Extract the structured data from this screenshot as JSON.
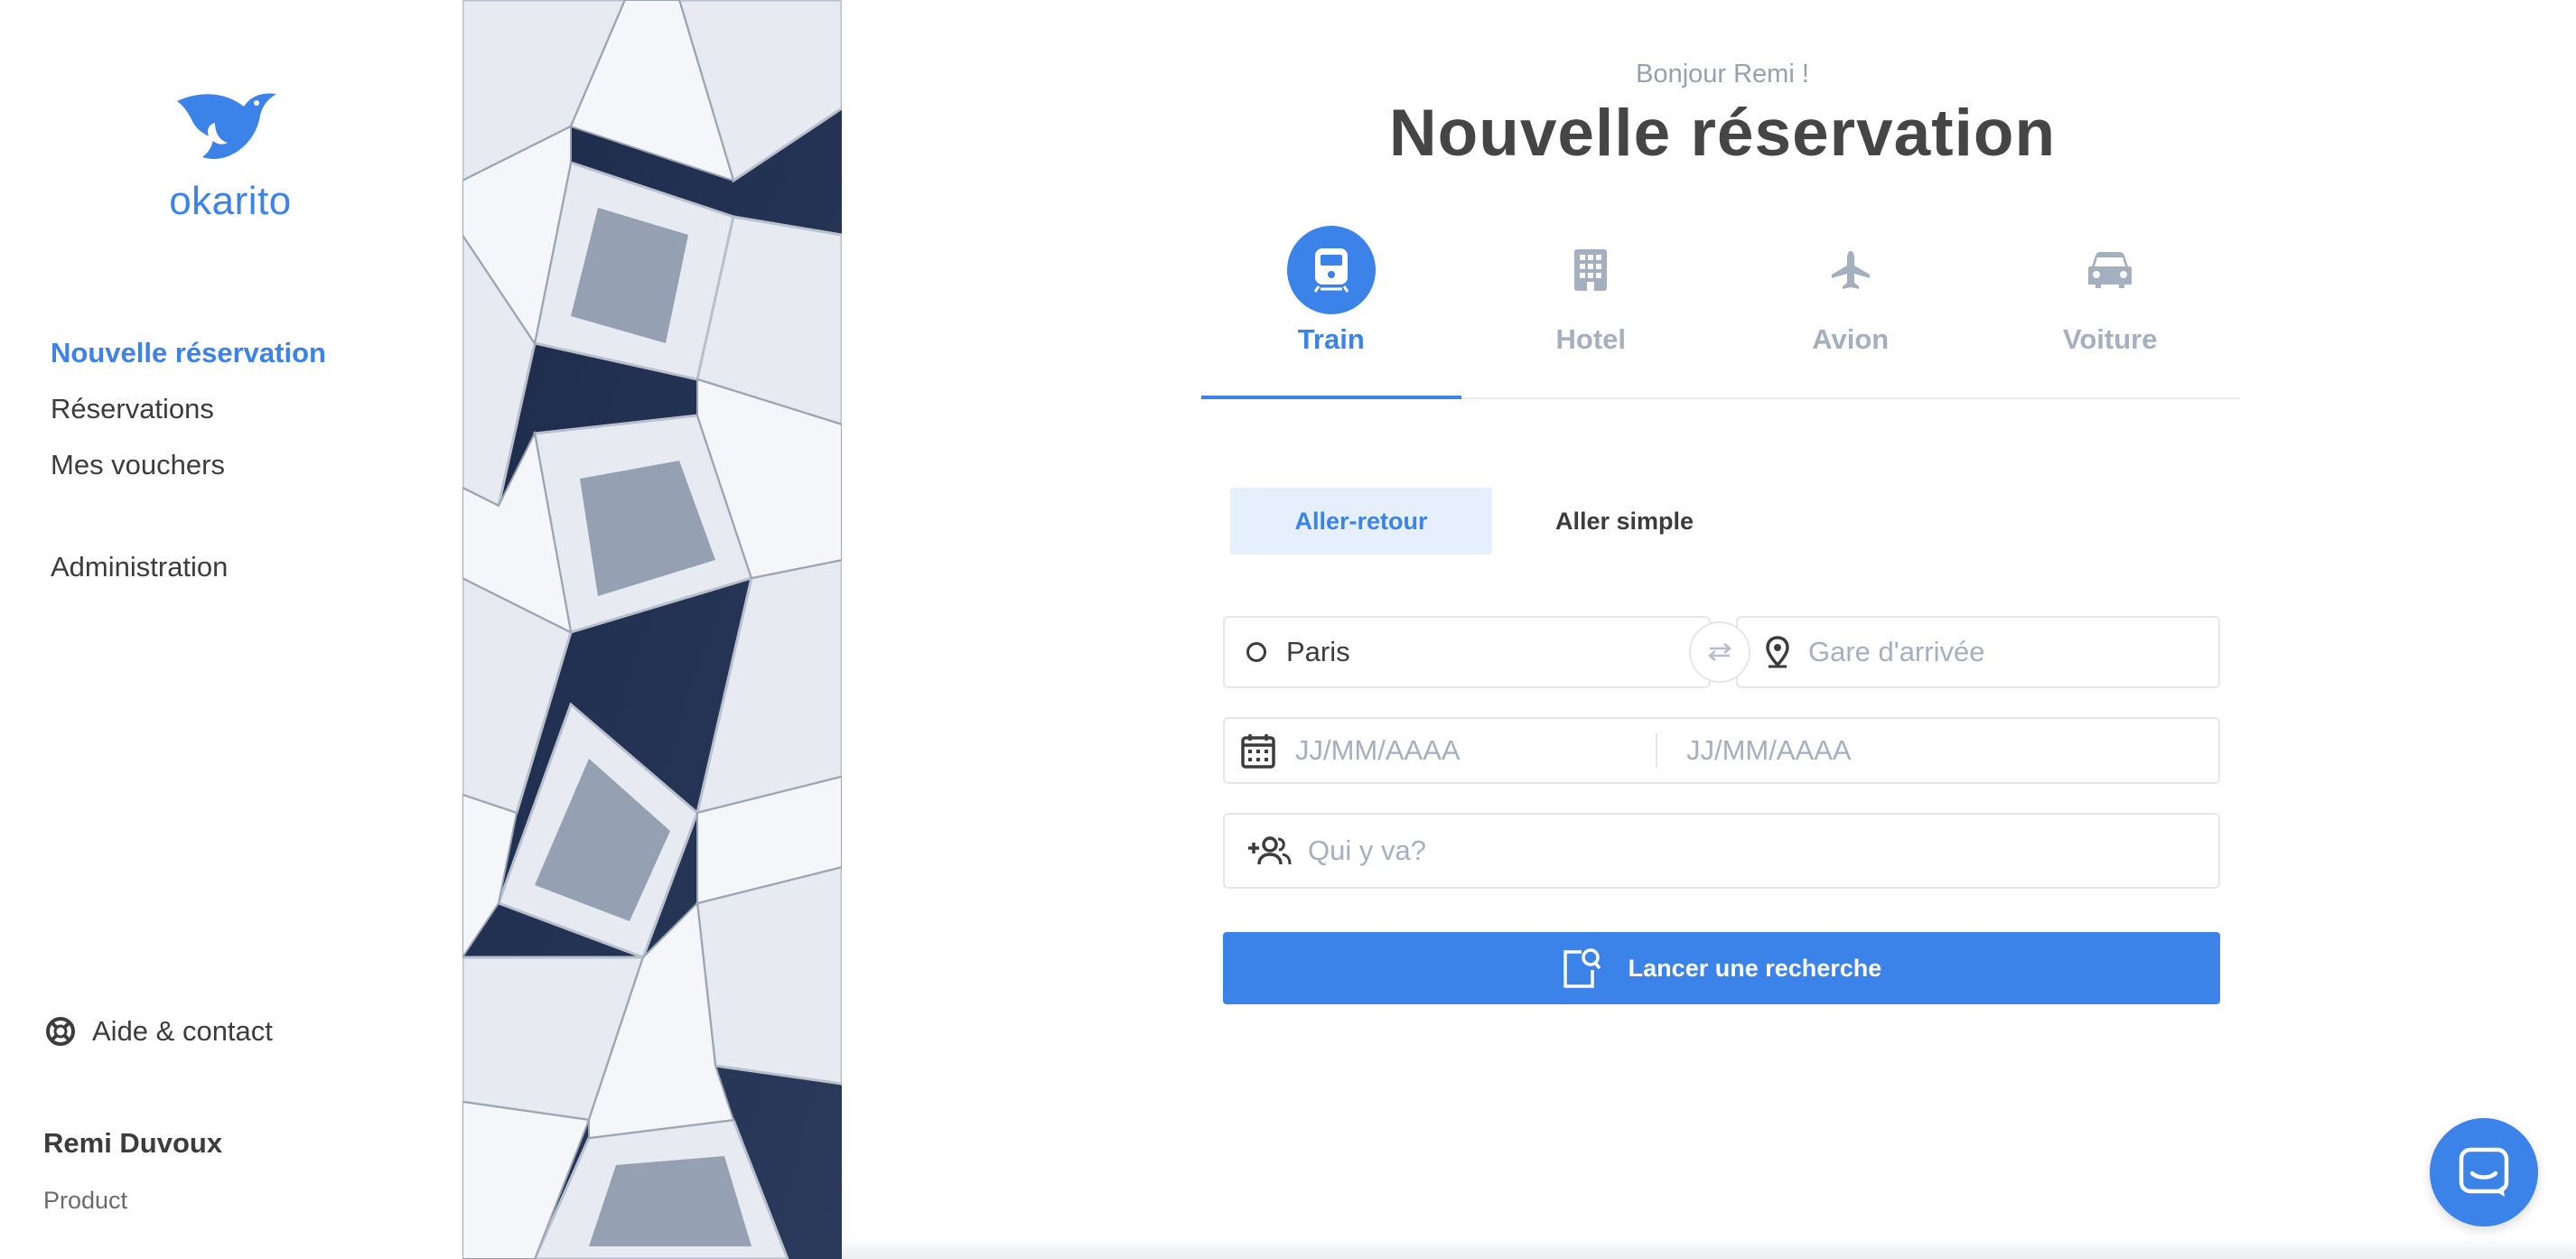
{
  "brand": {
    "name": "okarito",
    "accent": "#3b82e9"
  },
  "sidebar": {
    "nav": [
      {
        "label": "Nouvelle réservation",
        "active": true
      },
      {
        "label": "Réservations",
        "active": false
      },
      {
        "label": "Mes vouchers",
        "active": false
      }
    ],
    "admin_label": "Administration",
    "help_label": "Aide & contact",
    "user": {
      "name": "Remi Duvoux",
      "role": "Product"
    }
  },
  "header": {
    "greeting": "Bonjour Remi !",
    "title": "Nouvelle réservation"
  },
  "tabs": [
    {
      "label": "Train",
      "icon": "train-icon",
      "active": true
    },
    {
      "label": "Hotel",
      "icon": "hotel-icon",
      "active": false
    },
    {
      "label": "Avion",
      "icon": "plane-icon",
      "active": false
    },
    {
      "label": "Voiture",
      "icon": "car-icon",
      "active": false
    }
  ],
  "trip_type": {
    "round_trip": "Aller-retour",
    "one_way": "Aller simple",
    "selected": "Aller-retour"
  },
  "form": {
    "from_value": "Paris",
    "to_placeholder": "Gare d'arrivée",
    "date_out_placeholder": "JJ/MM/AAAA",
    "date_back_placeholder": "JJ/MM/AAAA",
    "travelers_placeholder": "Qui y va?",
    "search_label": "Lancer une recherche"
  }
}
